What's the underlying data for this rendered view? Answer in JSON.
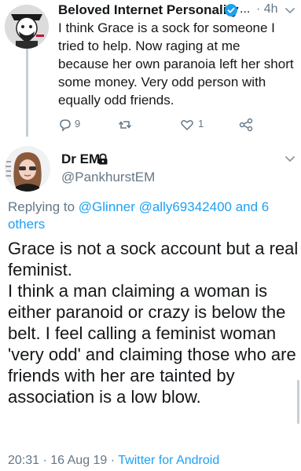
{
  "tweet1": {
    "display_name": "Beloved Internet Personality",
    "ellipsis": "...",
    "time": "· 4h",
    "text": "I think Grace is a sock for someone I tried to help. Now raging at me because her own paranoia left her short some money. Very odd person with equally odd friends.",
    "reply_count": "9",
    "like_count": "1"
  },
  "tweet2": {
    "display_name": "Dr EM",
    "handle": "@PankhurstEM",
    "replying_prefix": "Replying to",
    "replying_targets": "@Glinner @ally69342400 and 6 others",
    "text": "Grace is not a sock account but a real feminist.\nI think a man claiming a woman is either paranoid or crazy is below the belt. I feel calling a feminist woman 'very odd' and claiming those who are friends with her are tainted by association is a low blow.",
    "timestamp": "20:31 · 16 Aug 19 · ",
    "source": "Twitter for Android"
  },
  "colors": {
    "link": "#1da1f2",
    "secondary": "#657786",
    "primary": "#14171a"
  }
}
